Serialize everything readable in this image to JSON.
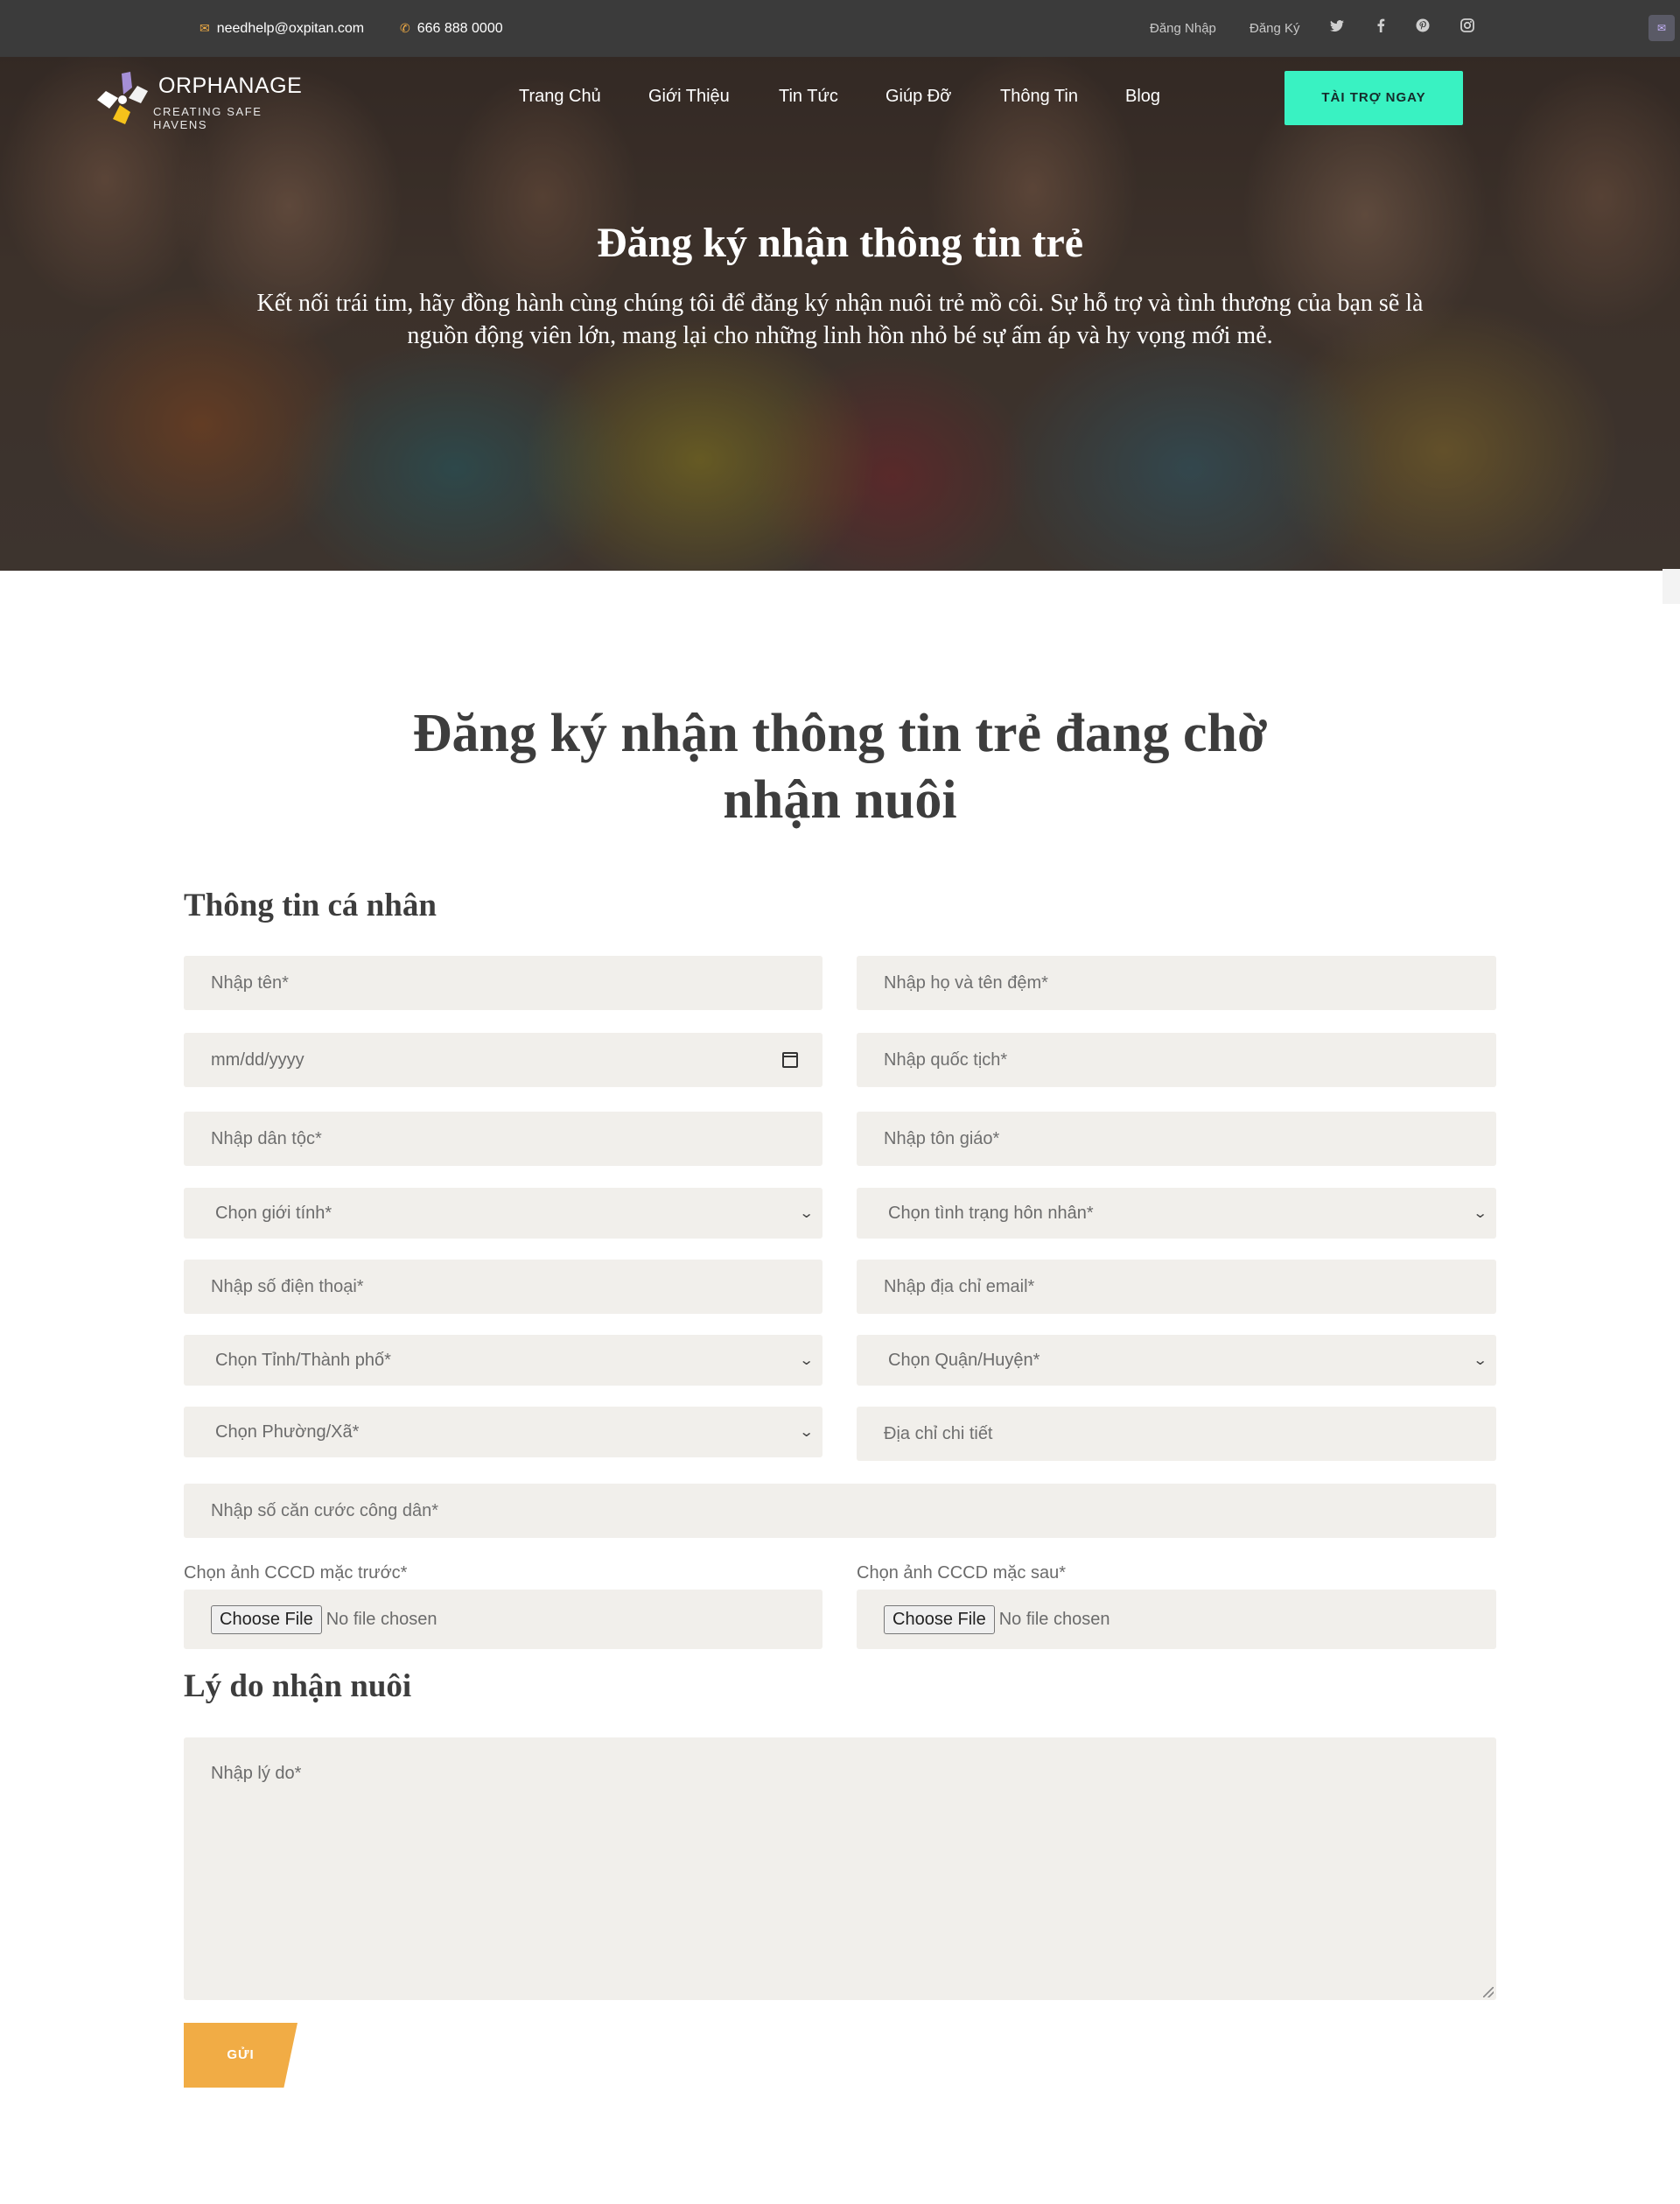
{
  "topbar": {
    "email": "needhelp@oxpitan.com",
    "phone": "666 888 0000",
    "login": "Đăng Nhập",
    "register": "Đăng Ký",
    "social_icons": [
      "twitter-icon",
      "facebook-icon",
      "pinterest-icon",
      "instagram-icon"
    ]
  },
  "brand": {
    "name": "ORPHANAGE",
    "tagline": "CREATING SAFE HAVENS"
  },
  "nav": {
    "items": [
      "Trang Chủ",
      "Giới Thiệu",
      "Tin Tức",
      "Giúp Đỡ",
      "Thông Tin",
      "Blog"
    ],
    "donate_label": "TÀI TRỢ NGAY"
  },
  "hero": {
    "title": "Đăng ký nhận thông tin trẻ",
    "subtitle": "Kết nối trái tim, hãy đồng hành cùng chúng tôi để đăng ký nhận nuôi trẻ mồ côi. Sự hỗ trợ và tình thương của bạn sẽ là nguồn động viên lớn, mang lại cho những linh hồn nhỏ bé sự ấm áp và hy vọng mới mẻ."
  },
  "form": {
    "title": "Đăng ký nhận thông tin trẻ đang chờ nhận nuôi",
    "personal_heading": "Thông tin cá nhân",
    "first_name": "Nhập tên*",
    "last_name": "Nhập họ và tên đệm*",
    "dob": "mm/dd/yyyy",
    "nationality": "Nhập quốc tịch*",
    "ethnicity": "Nhập dân tộc*",
    "religion": "Nhập tôn giáo*",
    "gender": "Chọn giới tính*",
    "marital": "Chọn tình trạng hôn nhân*",
    "phone": "Nhập số điện thoại*",
    "email": "Nhập địa chỉ email*",
    "province": "Chọn Tỉnh/Thành phố*",
    "district": "Chọn Quận/Huyện*",
    "ward": "Chọn Phường/Xã*",
    "address": "Địa chỉ chi tiết",
    "id_number": "Nhập số căn cước công dân*",
    "id_front_label": "Chọn ảnh CCCD mặc trước*",
    "id_back_label": "Chọn ảnh CCCD mặc sau*",
    "choose_file": "Choose File",
    "no_file": "No file chosen",
    "reason_heading": "Lý do nhận nuôi",
    "reason": "Nhập lý do*",
    "submit": "GỬI"
  },
  "colors": {
    "accent": "#f1ac45",
    "donate": "#39f2c2",
    "topbar": "#3b3b3b",
    "field_bg": "#f1efeb"
  }
}
